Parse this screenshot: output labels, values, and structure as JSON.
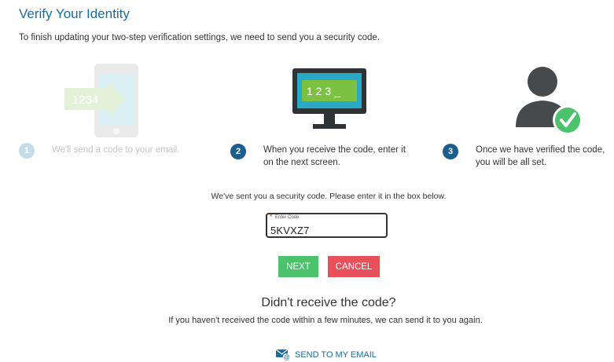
{
  "header": {
    "title": "Verify Your Identity",
    "intro": "To finish updating your two-step verification settings, we need to send you a security code."
  },
  "steps": [
    {
      "number": "1",
      "text": "We'll send a code to your email.",
      "illustration": "phone-icon",
      "illustration_text": "1234",
      "state": "done"
    },
    {
      "number": "2",
      "text_line1": "When you receive the code, enter it",
      "text_line2": "on the next screen.",
      "illustration": "monitor-icon",
      "illustration_text": "1 2 3 _",
      "state": "active"
    },
    {
      "number": "3",
      "text_line1": "Once we have verified the code,",
      "text_line2": "you will be all set.",
      "illustration": "verified-user-icon",
      "state": "pending"
    }
  ],
  "code_entry": {
    "message": "We've sent you a security code. Please enter it in the box below.",
    "label": "Enter Code",
    "required_marker": "*",
    "value": "5KVXZ7"
  },
  "buttons": {
    "next": "NEXT",
    "cancel": "CANCEL"
  },
  "resend": {
    "heading": "Didn't receive the code?",
    "message": "If you haven't received the code within a few minutes, we can send it to you again.",
    "link": "SEND TO MY EMAIL",
    "link_icon": "email-icon"
  },
  "colors": {
    "title": "#1a6ca0",
    "step_active": "#1d5e8c",
    "step_done": "#c3dde9",
    "next": "#4cc26c",
    "cancel": "#e8505b",
    "check": "#4cc26c"
  }
}
